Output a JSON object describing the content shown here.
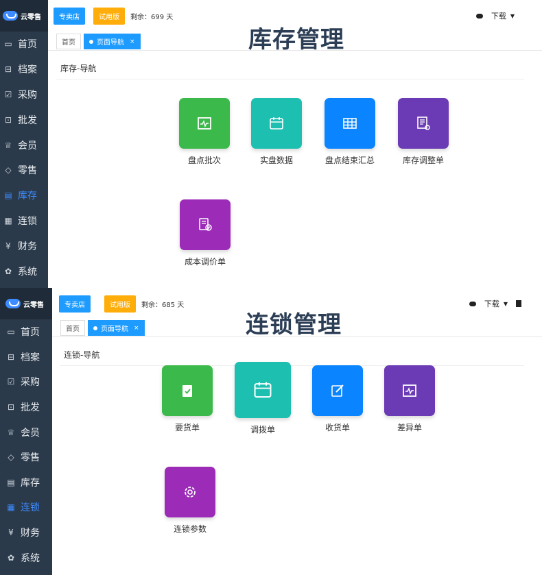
{
  "panel1": {
    "logo": "云零售",
    "btn_store": "专卖店",
    "btn_trial": "试用版",
    "remaining": "剩余：699 天",
    "download": "下载",
    "title": "库存管理",
    "tab_home": "首页",
    "tab_active": "页面导航",
    "tab_close": "×",
    "section": "库存-导航",
    "nav": [
      "首页",
      "档案",
      "采购",
      "批发",
      "会员",
      "零售",
      "库存",
      "连锁",
      "财务",
      "系统"
    ],
    "active_index": 6,
    "tiles": [
      "盘点批次",
      "实盘数据",
      "盘点结束汇总",
      "库存调整单",
      "成本调价单"
    ]
  },
  "panel2": {
    "logo": "云零售",
    "btn_store": "专卖店",
    "btn_trial": "试用版",
    "remaining": "剩余：685 天",
    "download": "下载",
    "title": "连锁管理",
    "tab_home": "首页",
    "tab_active": "页面导航",
    "tab_close": "×",
    "section": "连锁-导航",
    "nav": [
      "首页",
      "档案",
      "采购",
      "批发",
      "会员",
      "零售",
      "库存",
      "连锁",
      "财务",
      "系统"
    ],
    "active_index": 7,
    "tiles": [
      "要货单",
      "调拨单",
      "收货单",
      "差异单",
      "连锁参数"
    ]
  },
  "icons": [
    "home-icon",
    "archive-icon",
    "purchase-icon",
    "wholesale-icon",
    "member-icon",
    "retail-icon",
    "inventory-icon",
    "chain-icon",
    "finance-icon",
    "settings-icon"
  ],
  "colors": {
    "sidebar": "#2b3a4a",
    "accent": "#1e9bff",
    "trial": "#ffad0a",
    "green": "#3cb94b",
    "teal": "#1cbfb0",
    "blue": "#0a84ff",
    "purple": "#6b3ab5",
    "magenta": "#9c2bb8"
  }
}
